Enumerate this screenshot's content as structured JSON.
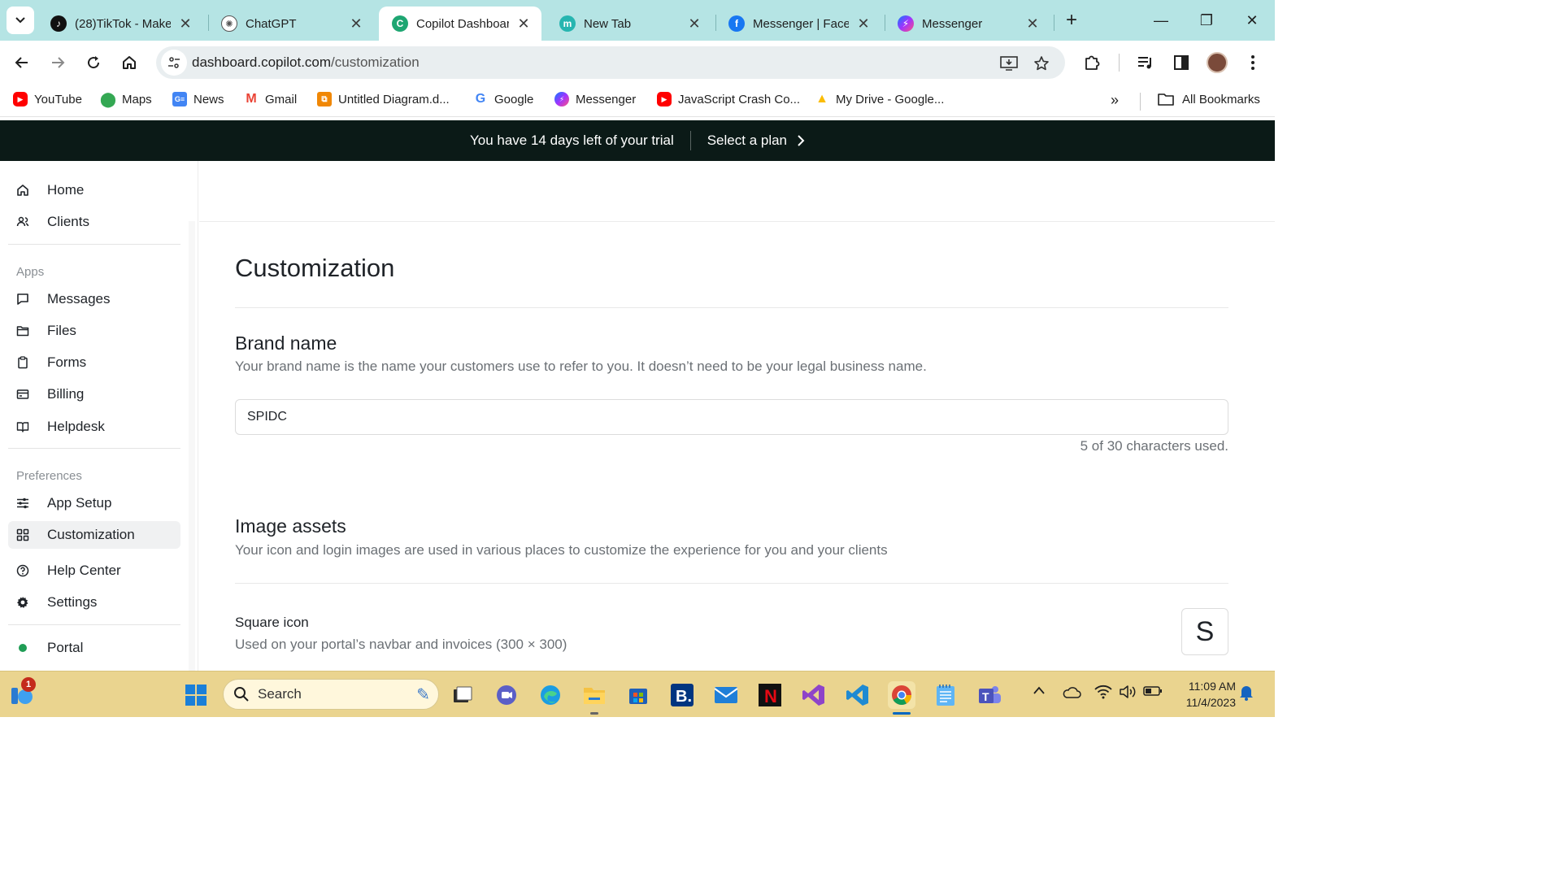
{
  "browser": {
    "tabs": [
      {
        "title": "(28)TikTok - Make",
        "icon": "tiktok-icon",
        "active": false
      },
      {
        "title": "ChatGPT",
        "icon": "chatgpt-icon",
        "active": false
      },
      {
        "title": "Copilot Dashboard",
        "icon": "copilot-icon",
        "active": true
      },
      {
        "title": "New Tab",
        "icon": "new-tab-icon",
        "active": false
      },
      {
        "title": "Messenger | Facebook",
        "icon": "facebook-icon",
        "active": false
      },
      {
        "title": "Messenger",
        "icon": "messenger-icon",
        "active": false
      }
    ],
    "url_host": "dashboard.copilot.com",
    "url_path": "/customization",
    "bookmarks": [
      {
        "label": "YouTube",
        "icon": "youtube-icon"
      },
      {
        "label": "Maps",
        "icon": "maps-icon"
      },
      {
        "label": "News",
        "icon": "news-icon"
      },
      {
        "label": "Gmail",
        "icon": "gmail-icon"
      },
      {
        "label": "Untitled Diagram.d...",
        "icon": "drawio-icon"
      },
      {
        "label": "Google",
        "icon": "google-icon"
      },
      {
        "label": "Messenger",
        "icon": "messenger-icon"
      },
      {
        "label": "JavaScript Crash Co...",
        "icon": "youtube-icon"
      },
      {
        "label": "My Drive - Google...",
        "icon": "drive-icon"
      }
    ],
    "all_bookmarks_label": "All Bookmarks"
  },
  "banner": {
    "trial_text": "You have 14 days left of your trial",
    "plan_label": "Select a plan"
  },
  "sidebar": {
    "top_items": [
      {
        "label": "Home",
        "icon": "home-icon"
      },
      {
        "label": "Clients",
        "icon": "clients-icon"
      }
    ],
    "apps_heading": "Apps",
    "app_items": [
      {
        "label": "Messages",
        "icon": "messages-icon"
      },
      {
        "label": "Files",
        "icon": "folder-icon"
      },
      {
        "label": "Forms",
        "icon": "clipboard-icon"
      },
      {
        "label": "Billing",
        "icon": "card-icon"
      },
      {
        "label": "Helpdesk",
        "icon": "book-icon"
      }
    ],
    "preferences_heading": "Preferences",
    "pref_items": [
      {
        "label": "App Setup",
        "icon": "sliders-icon"
      },
      {
        "label": "Customization",
        "icon": "grid-icon",
        "active": true
      }
    ],
    "bottom_items": [
      {
        "label": "Help Center",
        "icon": "help-icon"
      },
      {
        "label": "Settings",
        "icon": "gear-icon"
      }
    ],
    "portal_label": "Portal",
    "portal_status_color": "#1f9d55"
  },
  "main": {
    "page_title": "Customization",
    "brand": {
      "title": "Brand name",
      "description": "Your brand name is the name your customers use to refer to you. It doesn’t need to be your legal business name.",
      "value": "SPIDC",
      "counter": "5 of 30 characters used."
    },
    "images": {
      "title": "Image assets",
      "description": "Your icon and login images are used in various places to customize the experience for you and your clients",
      "square_icon_title": "Square icon",
      "square_icon_desc": "Used on your portal’s navbar and invoices (300 × 300)",
      "square_icon_letter": "S"
    }
  },
  "taskbar": {
    "search_placeholder": "Search",
    "notification_count": "1",
    "time": "11:09 AM",
    "date": "11/4/2023"
  },
  "colors": {
    "tabstrip": "#b5e4e4",
    "banner": "#0b1a17",
    "taskbar": "#ead48f",
    "copilot_green": "#1ea672"
  }
}
